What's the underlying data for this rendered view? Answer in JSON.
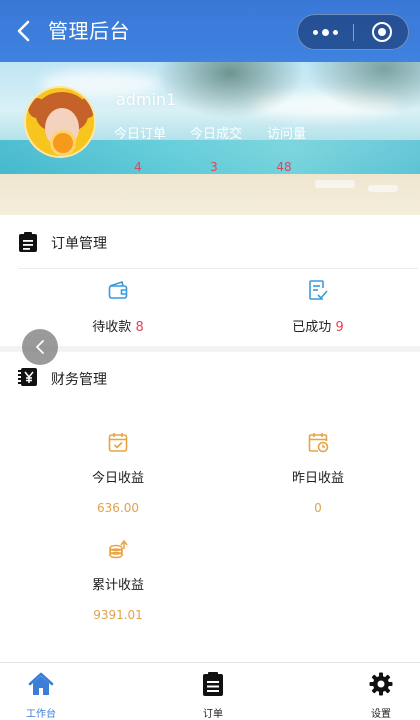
{
  "navbar": {
    "title": "管理后台",
    "back_icon": "chevron-left-icon",
    "more_icon": "more-dots-icon",
    "close_icon": "target-circle-icon"
  },
  "profile": {
    "username": "admin1",
    "stats": [
      {
        "label": "今日订单",
        "value": "4"
      },
      {
        "label": "今日成交",
        "value": "3"
      },
      {
        "label": "访问量",
        "value": "48"
      }
    ]
  },
  "orders": {
    "title": "订单管理",
    "icon": "clipboard-icon",
    "items": [
      {
        "label": "待收款",
        "count": "8",
        "icon": "wallet-icon"
      },
      {
        "label": "已成功",
        "count": "9",
        "icon": "checklist-icon"
      }
    ]
  },
  "finance": {
    "title": "财务管理",
    "icon": "yen-icon",
    "items": [
      {
        "label": "今日收益",
        "amount": "636.00",
        "icon": "calendar-check-icon"
      },
      {
        "label": "昨日收益",
        "amount": "0",
        "icon": "calendar-clock-icon"
      },
      {
        "label": "累计收益",
        "amount": "9391.01",
        "icon": "coin-stack-icon"
      }
    ]
  },
  "tabbar": {
    "tabs": [
      {
        "label": "工作台",
        "icon": "home-icon",
        "active": true
      },
      {
        "label": "订单",
        "icon": "clipboard-icon",
        "active": false
      },
      {
        "label": "设置",
        "icon": "gear-icon",
        "active": false
      }
    ]
  },
  "colors": {
    "primary": "#3a7ed8",
    "count_red": "#e0445a",
    "amount_orange": "#e0a24b",
    "icon_blue": "#3a9ad9",
    "icon_orange": "#e9a341"
  }
}
